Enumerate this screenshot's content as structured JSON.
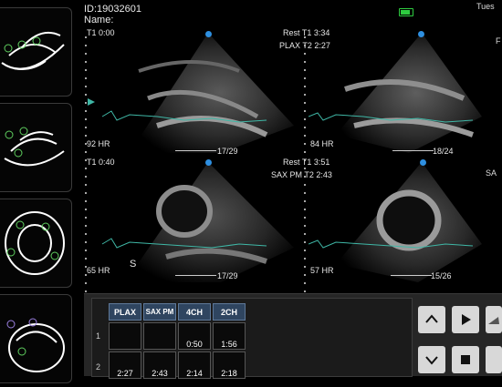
{
  "patient": {
    "id": "ID:19032601",
    "name_label": "Name:"
  },
  "header_right": "Tues",
  "sidebar_right_marks": [
    "F",
    "SA"
  ],
  "panels": [
    {
      "tl": "T1 0:00",
      "tr_a": "Rest T1 3:34",
      "tr_b": "",
      "hr": "92 HR",
      "frames": "17/29",
      "extra": ""
    },
    {
      "tl": "",
      "tr_a": "",
      "tr_b": "",
      "hr": "84 HR",
      "frames": "18/24",
      "extra": ""
    },
    {
      "tl": "T1 0:40",
      "tr_a": "",
      "tr_b": "",
      "hr": "65 HR",
      "frames": "17/29",
      "extra": "S"
    },
    {
      "tl": "",
      "tr_a": "Rest T1 3:51",
      "tr_b": "",
      "hr": "57 HR",
      "frames": "15/26",
      "extra": ""
    }
  ],
  "view_labels": {
    "top": "PLAX T2 2:27",
    "bottom": "SAX PM T2 2:43"
  },
  "grid": {
    "columns": [
      "PLAX",
      "SAX PM",
      "4CH",
      "2CH"
    ],
    "rows": [
      {
        "label": "1",
        "cells": [
          "",
          "",
          "0:50",
          "1:56"
        ]
      },
      {
        "label": "2",
        "cells": [
          "2:27",
          "2:43",
          "2:14",
          "2:18"
        ]
      }
    ]
  },
  "controls": [
    "up-arrow-icon",
    "play-icon",
    "probe-icon",
    "down-arrow-icon",
    "stop-icon"
  ],
  "colors": {
    "accent": "#2f4560",
    "ecg": "#3fb7a6",
    "marker": "#2e8fe0",
    "battery": "#2ecc40"
  }
}
